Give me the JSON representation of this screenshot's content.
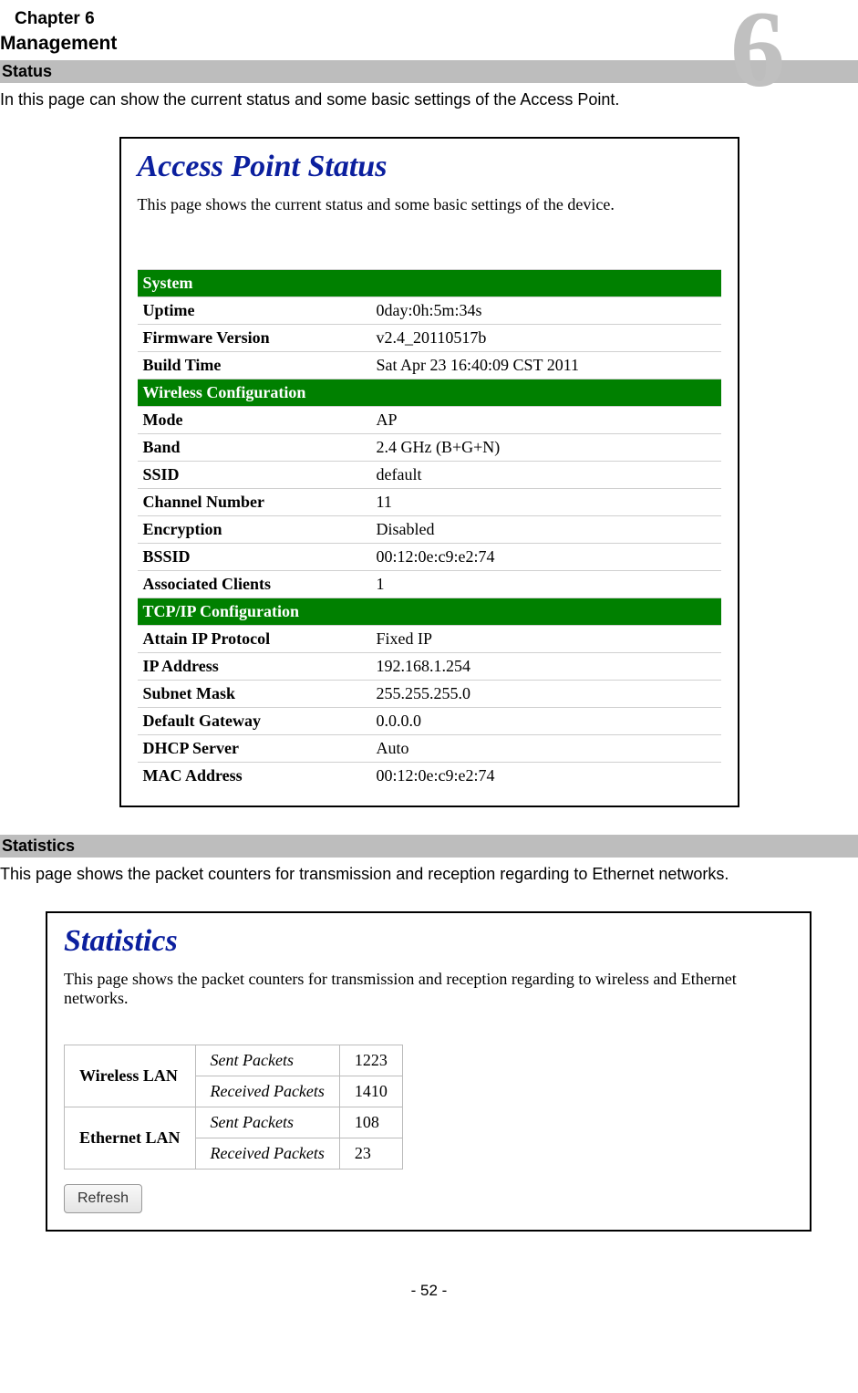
{
  "chapter_label": "Chapter 6",
  "management_label": "Management",
  "big_number": "6",
  "sections": {
    "status": {
      "heading": "Status",
      "intro": "In this page can show the current status and some basic settings of the Access Point.",
      "panel_title": "Access Point Status",
      "panel_subtitle": "This page shows the current status and some basic settings of the device.",
      "groups": [
        {
          "header": "System",
          "rows": [
            {
              "label": "Uptime",
              "value": "0day:0h:5m:34s"
            },
            {
              "label": "Firmware Version",
              "value": "v2.4_20110517b"
            },
            {
              "label": "Build Time",
              "value": "Sat Apr 23 16:40:09 CST 2011"
            }
          ]
        },
        {
          "header": "Wireless Configuration",
          "rows": [
            {
              "label": "Mode",
              "value": "AP"
            },
            {
              "label": "Band",
              "value": "2.4 GHz (B+G+N)"
            },
            {
              "label": "SSID",
              "value": "default",
              "mono": true
            },
            {
              "label": "Channel Number",
              "value": "11"
            },
            {
              "label": "Encryption",
              "value": "Disabled"
            },
            {
              "label": "BSSID",
              "value": "00:12:0e:c9:e2:74"
            },
            {
              "label": "Associated Clients",
              "value": "1"
            }
          ]
        },
        {
          "header": "TCP/IP Configuration",
          "rows": [
            {
              "label": "Attain IP Protocol",
              "value": "Fixed IP"
            },
            {
              "label": "IP Address",
              "value": "192.168.1.254"
            },
            {
              "label": "Subnet Mask",
              "value": "255.255.255.0"
            },
            {
              "label": "Default Gateway",
              "value": "0.0.0.0"
            },
            {
              "label": "DHCP Server",
              "value": "Auto"
            },
            {
              "label": "MAC Address",
              "value": "00:12:0e:c9:e2:74"
            }
          ]
        }
      ]
    },
    "statistics": {
      "heading": "Statistics",
      "intro": "This page shows the packet counters for transmission and reception regarding to Ethernet networks.",
      "panel_title": "Statistics",
      "panel_subtitle": "This page shows the packet counters for transmission and reception regarding to wireless and Ethernet networks.",
      "interfaces": [
        {
          "name": "Wireless LAN",
          "metrics": [
            {
              "label": "Sent Packets",
              "value": "1223"
            },
            {
              "label": "Received Packets",
              "value": "1410"
            }
          ]
        },
        {
          "name": "Ethernet LAN",
          "metrics": [
            {
              "label": "Sent Packets",
              "value": "108"
            },
            {
              "label": "Received Packets",
              "value": "23"
            }
          ]
        }
      ],
      "refresh_label": "Refresh"
    }
  },
  "page_number": "- 52 -"
}
